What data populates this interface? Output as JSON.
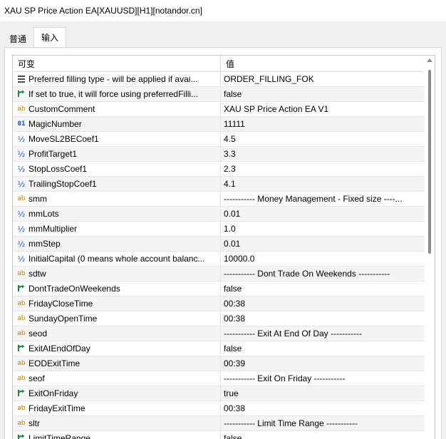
{
  "window": {
    "title": "XAU SP Price Action EA[XAUUSD][H1][notandor.cn]"
  },
  "tabs": [
    {
      "label": "普通"
    },
    {
      "label": "输入"
    }
  ],
  "grid": {
    "columns": {
      "variable": "可变",
      "value": "值"
    },
    "rows": [
      {
        "icon": "enum",
        "name": "Preferred filling type - will be applied if avai...",
        "value": "ORDER_FILLING_FOK"
      },
      {
        "icon": "bool",
        "name": "If set to true, it will force using preferredFilli...",
        "value": "false"
      },
      {
        "icon": "ab",
        "name": "CustomComment",
        "value": "XAU SP Price Action EA V1"
      },
      {
        "icon": "01",
        "name": "MagicNumber",
        "value": "11111"
      },
      {
        "icon": "half",
        "name": "MoveSL2BECoef1",
        "value": "4.5"
      },
      {
        "icon": "half",
        "name": "ProfitTarget1",
        "value": "3.3"
      },
      {
        "icon": "half",
        "name": "StopLossCoef1",
        "value": "2.3"
      },
      {
        "icon": "half",
        "name": "TrailingStopCoef1",
        "value": "4.1"
      },
      {
        "icon": "ab",
        "name": "smm",
        "value": "----------- Money Management - Fixed size ----..."
      },
      {
        "icon": "half",
        "name": "mmLots",
        "value": "0.01"
      },
      {
        "icon": "half",
        "name": "mmMultiplier",
        "value": "1.0"
      },
      {
        "icon": "half",
        "name": "mmStep",
        "value": "0.01"
      },
      {
        "icon": "half",
        "name": "InitialCapital (0 means whole account balanc...",
        "value": "10000.0"
      },
      {
        "icon": "ab",
        "name": "sdtw",
        "value": "----------- Dont Trade On Weekends -----------"
      },
      {
        "icon": "bool",
        "name": "DontTradeOnWeekends",
        "value": "false"
      },
      {
        "icon": "ab",
        "name": "FridayCloseTime",
        "value": "00:38"
      },
      {
        "icon": "ab",
        "name": "SundayOpenTime",
        "value": "00:38"
      },
      {
        "icon": "ab",
        "name": "seod",
        "value": "----------- Exit At End Of Day -----------"
      },
      {
        "icon": "bool",
        "name": "ExitAtEndOfDay",
        "value": "false"
      },
      {
        "icon": "ab",
        "name": "EODExitTime",
        "value": "00:39"
      },
      {
        "icon": "ab",
        "name": "seof",
        "value": "----------- Exit On Friday -----------"
      },
      {
        "icon": "bool",
        "name": "ExitOnFriday",
        "value": "true"
      },
      {
        "icon": "ab",
        "name": "FridayExitTime",
        "value": "00:38"
      },
      {
        "icon": "ab",
        "name": "sltr",
        "value": "----------- Limit Time Range -----------"
      },
      {
        "icon": "bool",
        "name": "LimitTimeRange",
        "value": "false"
      }
    ]
  }
}
